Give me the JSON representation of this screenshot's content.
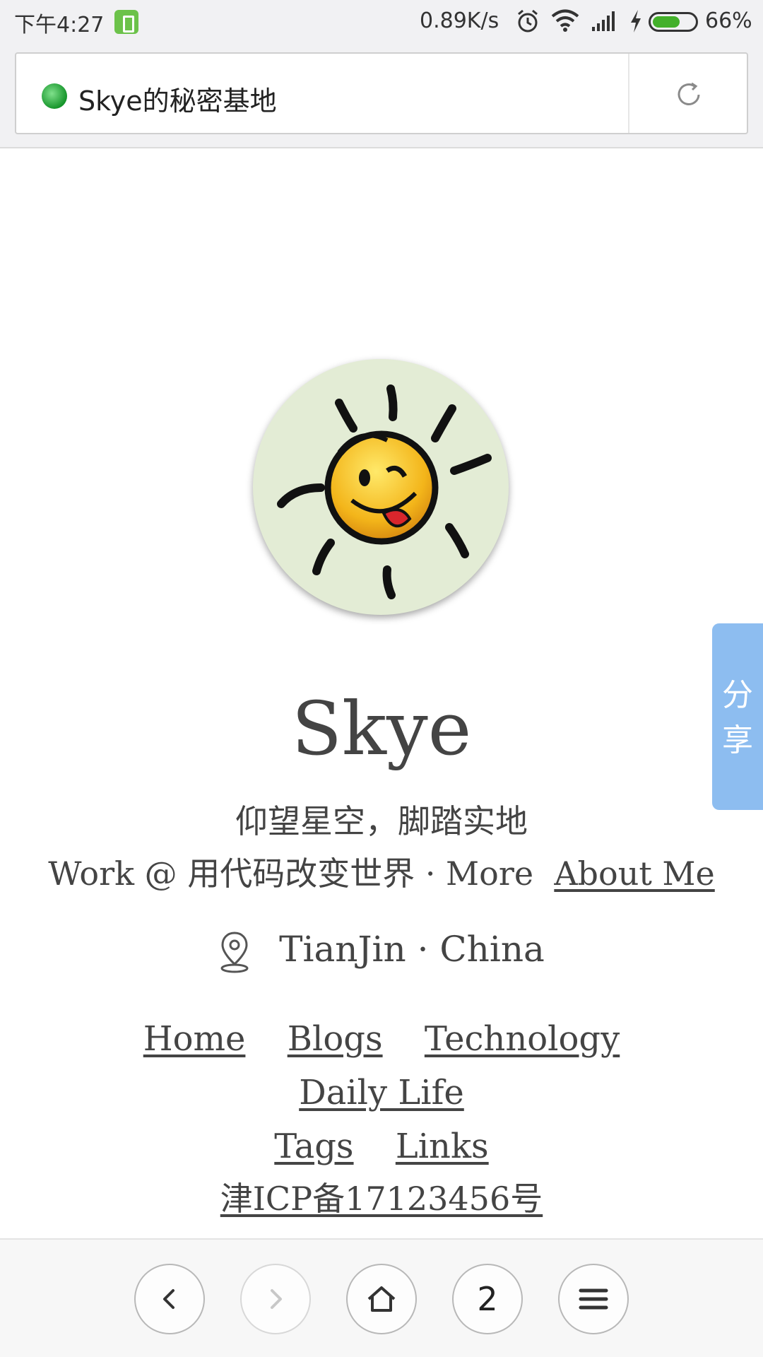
{
  "status_bar": {
    "time": "下午4:27",
    "net_speed": "0.89K/s",
    "battery_percent": "66%",
    "battery_level": 0.66,
    "icons": [
      "battery-app-icon",
      "alarm-icon",
      "wifi-icon",
      "signal-icon",
      "charging-icon",
      "battery-icon"
    ]
  },
  "browser": {
    "page_title": "Skye的秘密基地",
    "tab_count": "2",
    "icons": [
      "site-favicon-icon",
      "reload-icon",
      "back-icon",
      "forward-icon",
      "home-icon",
      "menu-icon"
    ]
  },
  "profile": {
    "name": "Skye",
    "motto": "仰望星空，脚踏实地",
    "work_text": "Work @ 用代码改变世界 · More",
    "about_link": "About Me",
    "location": "TianJin · China"
  },
  "nav": {
    "items": [
      "Home",
      "Blogs",
      "Technology",
      "Daily Life",
      "Tags",
      "Links"
    ]
  },
  "footer": {
    "icp": "津ICP备17123456号"
  },
  "share": {
    "label_1": "分",
    "label_2": "享",
    "color": "#8dbdf0"
  }
}
